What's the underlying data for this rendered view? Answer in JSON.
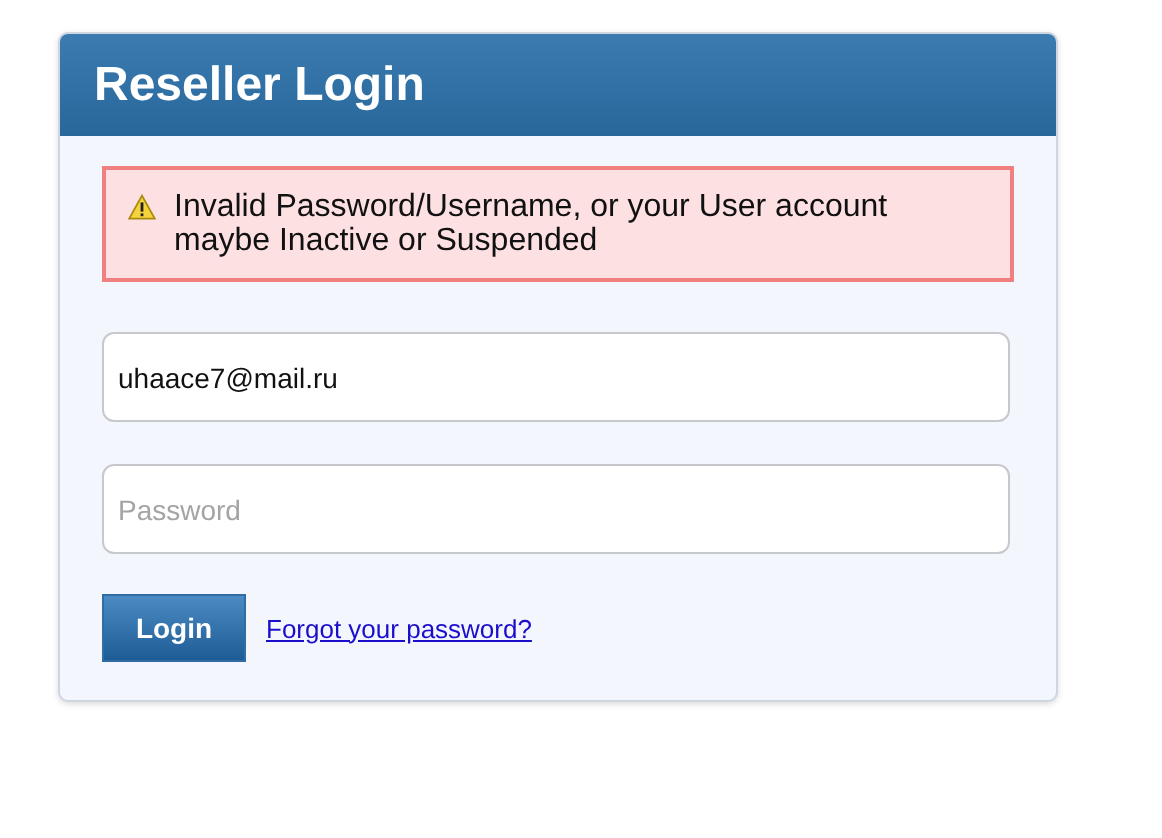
{
  "panel": {
    "title": "Reseller Login"
  },
  "alert": {
    "message": "Invalid Password/Username, or your User account maybe Inactive or Suspended"
  },
  "fields": [
    {
      "kind": "text",
      "value": "uhaace7@mail.ru"
    },
    {
      "kind": "password",
      "placeholder": "Password"
    }
  ],
  "login_button": "Login",
  "forgot_link": "Forgot your password?"
}
